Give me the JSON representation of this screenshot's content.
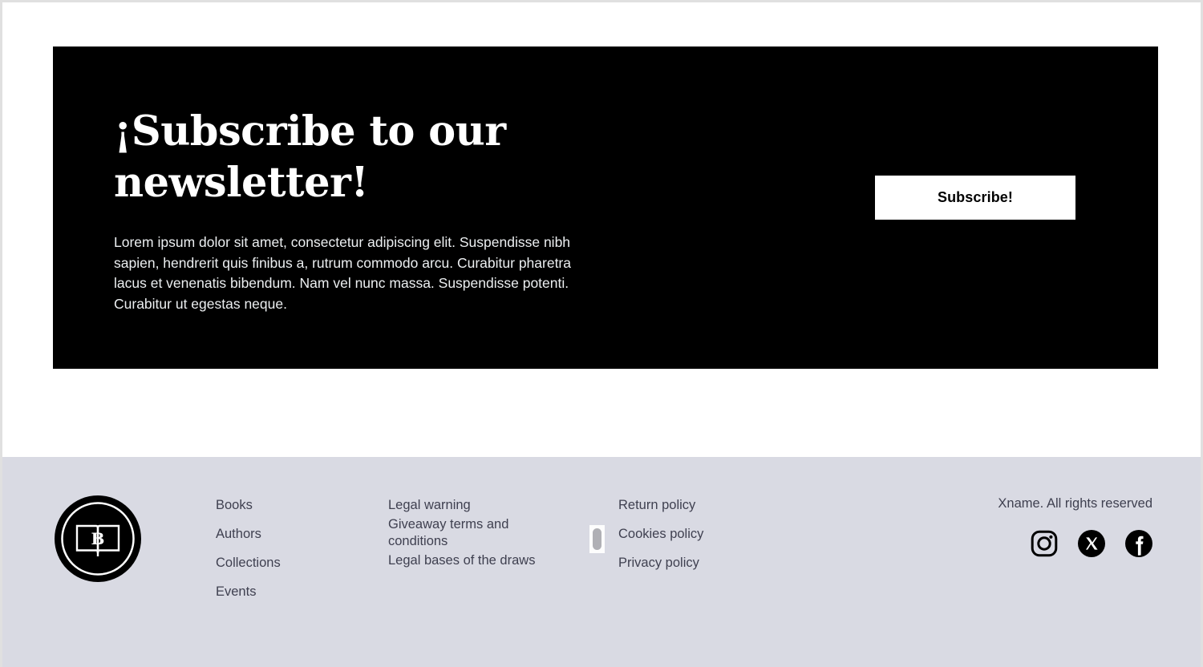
{
  "newsletter": {
    "title": "¡Subscribe to our newsletter!",
    "body": "Lorem ipsum dolor sit amet, consectetur adipiscing elit. Suspendisse nibh sapien, hendrerit quis finibus a, rutrum commodo arcu. Curabitur pharetra lacus et venenatis bibendum. Nam vel nunc massa. Suspendisse potenti. Curabitur ut egestas neque.",
    "subscribe_label": "Subscribe!",
    "panel_bg": "#000000",
    "button_bg": "#ffffff",
    "button_text_color": "#000000"
  },
  "footer": {
    "background": "#d9dae3",
    "text_color": "#3f4050",
    "logo": {
      "letter": "B",
      "icon_name": "book-logo-icon"
    },
    "columns": [
      {
        "name": "site-links",
        "items": [
          "Books",
          "Authors",
          "Collections",
          "Events"
        ]
      },
      {
        "name": "legal-links",
        "items": [
          "Legal warning",
          "Giveaway terms and conditions",
          "Legal bases of the draws"
        ]
      },
      {
        "name": "policy-links",
        "items": [
          "Return policy",
          "Cookies policy",
          "Privacy policy"
        ]
      }
    ],
    "copyright": "Xname. All rights reserved",
    "social": [
      {
        "name": "instagram",
        "label": "Instagram"
      },
      {
        "name": "x-twitter",
        "label": "X"
      },
      {
        "name": "facebook",
        "label": "Facebook"
      }
    ]
  }
}
